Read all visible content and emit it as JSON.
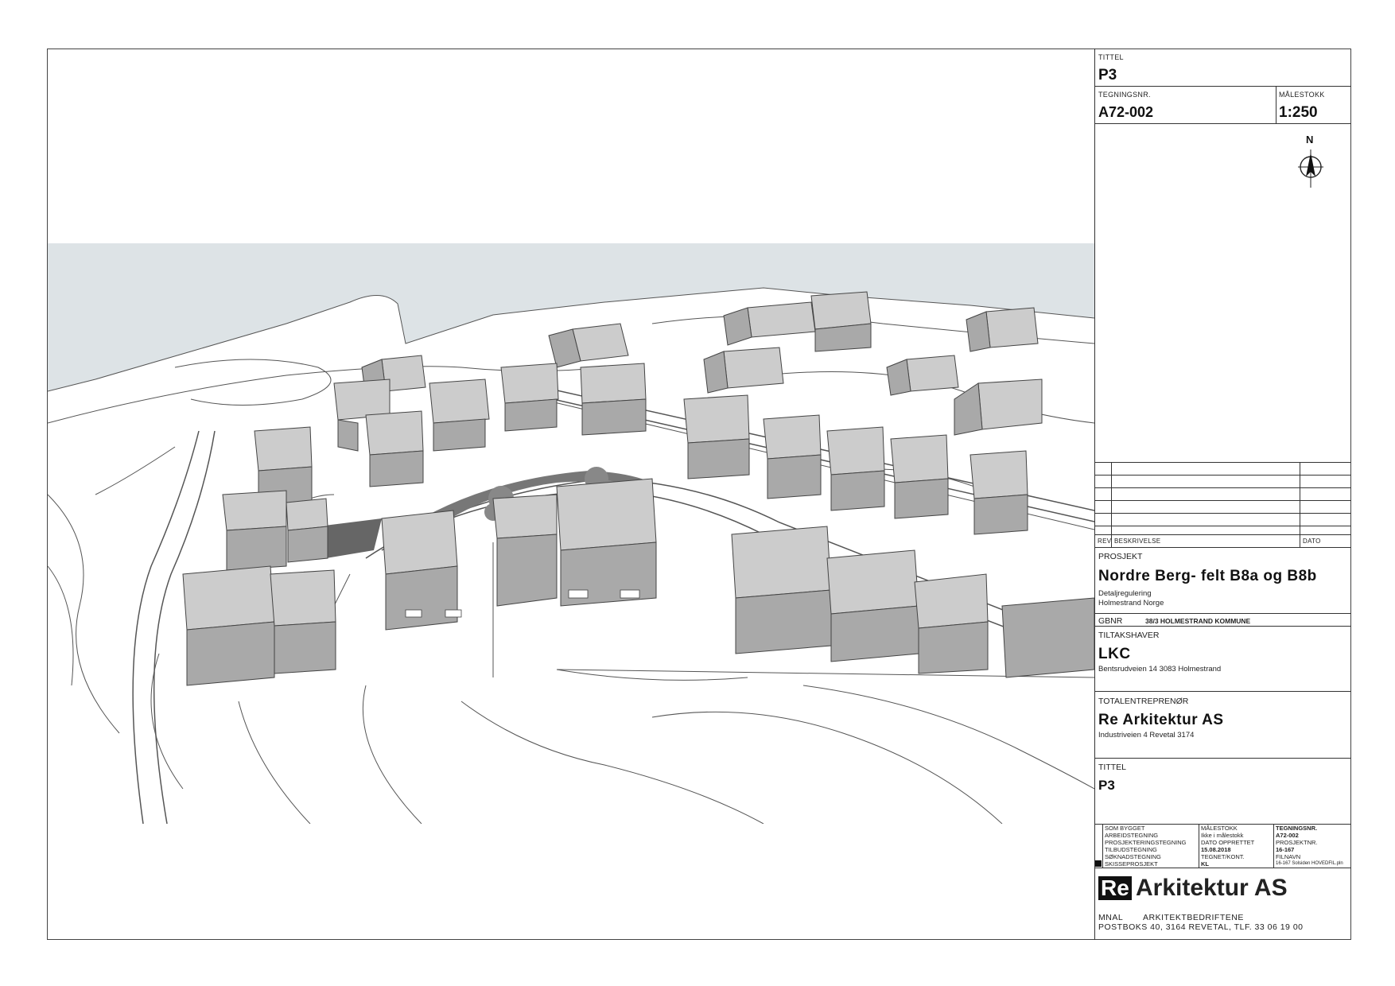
{
  "title_block": {
    "tittel_label": "TITTEL",
    "tittel_value": "P3",
    "tegningsnr_label": "TEGNINGSNR.",
    "tegningsnr_value": "A72-002",
    "malestokk_label": "MÅLESTOKK",
    "malestokk_value": "1:250",
    "north_label": "N"
  },
  "revision_table": {
    "rev_label": "REV",
    "beskrivelse_label": "BESKRIVELSE",
    "dato_label": "DATO"
  },
  "project": {
    "label": "PROSJEKT",
    "name": "Nordre Berg- felt B8a og B8b",
    "line1": "Detaljregulering",
    "line2": "Holmestrand Norge",
    "gbnr_label": "GBNR",
    "gbnr_value": "38/3 HOLMESTRAND KOMMUNE"
  },
  "owner": {
    "label": "TILTAKSHAVER",
    "name": "LKC",
    "address": "Bentsrudveien 14 3083 Holmestrand"
  },
  "contractor": {
    "label": "TOTALENTREPRENØR",
    "name": "Re Arkitektur AS",
    "address": "Industriveien 4 Revetal 3174"
  },
  "title2": {
    "label": "TITTEL",
    "value": "P3"
  },
  "status_table": {
    "col1": [
      "SOM BYGGET",
      "ARBEIDSTEGNING",
      "PROSJEKTERINGSTEGNING",
      "TILBUDSTEGNING",
      "SØKNADSTEGNING",
      "SKISSEPROSJEKT"
    ],
    "col2": [
      "MÅLESTOKK",
      "Ikke i målestokk",
      "DATO OPPRETTET",
      "15.08.2018",
      "TEGNET/KONT.",
      "KL"
    ],
    "col3": [
      "TEGNINGSNR.",
      "A72-002",
      "PROSJEKTNR.",
      "16-167",
      "FILNAVN",
      "16-167 Solsiden HOVEDFIL.pln"
    ]
  },
  "company": {
    "logo_re": "Re",
    "logo_name": "Arkitektur AS",
    "line1_a": "MNAL",
    "line1_b": "ARKITEKTBEDRIFTENE",
    "line2": "POSTBOKS 40, 3164 REVETAL, TLF. 33 06 19 00"
  },
  "colors": {
    "sky": "#dde3e6",
    "building": "#a9a9a9",
    "building_light": "#cfcfcf",
    "line": "#333333"
  }
}
